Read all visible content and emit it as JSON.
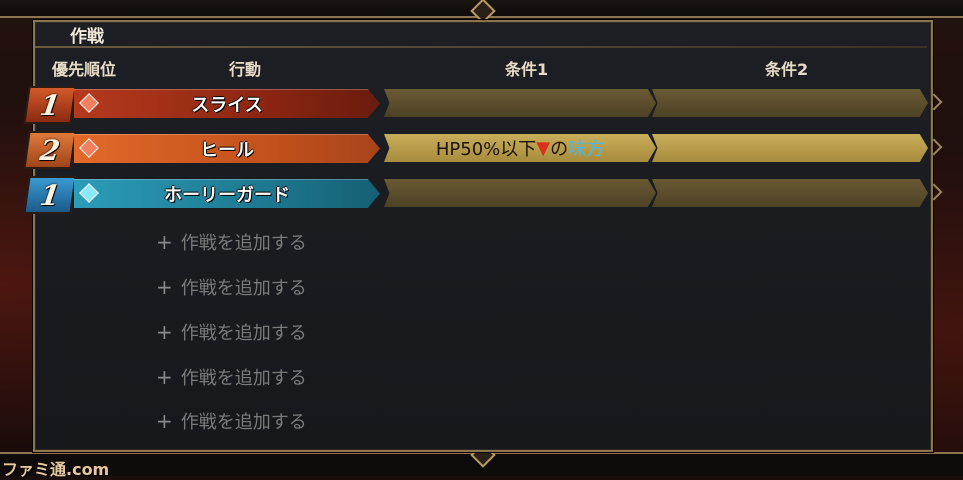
{
  "panel": {
    "title": "作戦"
  },
  "headers": {
    "priority": "優先順位",
    "action": "行動",
    "cond1": "条件1",
    "cond2": "条件2"
  },
  "rows": [
    {
      "priority": "1",
      "action": "スライス",
      "color": "red",
      "gem": "red",
      "cond1": "",
      "cond2": ""
    },
    {
      "priority": "2",
      "action": "ヒール",
      "color": "orange",
      "gem": "red",
      "cond1_prefix": "HP50%以下",
      "cond1_mark": "▼",
      "cond1_mid": "の",
      "cond1_target": "味方",
      "cond2": ""
    },
    {
      "priority": "1",
      "action": "ホーリーガード",
      "color": "blue",
      "gem": "blue",
      "cond1": "",
      "cond2": ""
    }
  ],
  "add_items": [
    {
      "plus": "+",
      "label": "作戦を追加する"
    },
    {
      "plus": "+",
      "label": "作戦を追加する"
    },
    {
      "plus": "+",
      "label": "作戦を追加する"
    },
    {
      "plus": "+",
      "label": "作戦を追加する"
    },
    {
      "plus": "+",
      "label": "作戦を追加する"
    }
  ],
  "watermark": "ファミ通.com"
}
